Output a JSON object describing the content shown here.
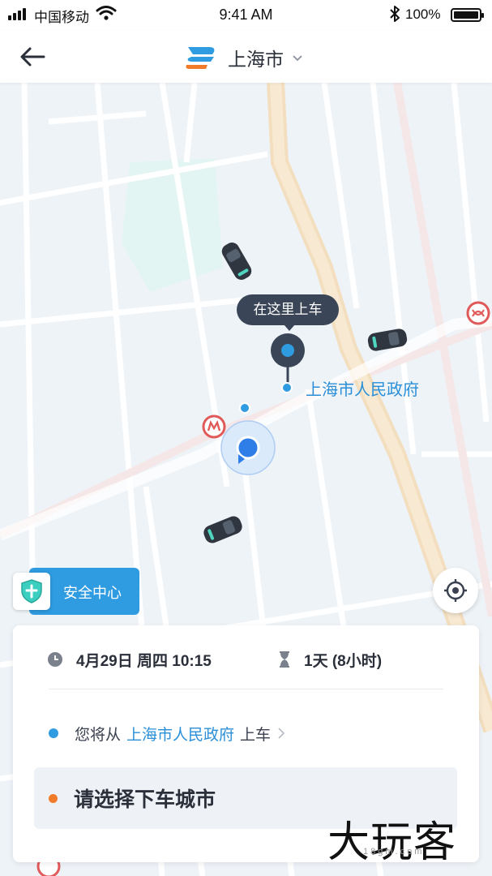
{
  "status_bar": {
    "carrier": "中国移动",
    "time": "9:41 AM",
    "battery_text": "100%",
    "battery_level": 1.0
  },
  "nav": {
    "back_icon": "back-arrow-icon",
    "logo_icon": "brand-logo-icon",
    "city": "上海市",
    "city_caret_icon": "chevron-down-icon"
  },
  "map": {
    "pickup_bubble": "在这里上车",
    "poi_label": "上海市人民政府",
    "metro_icon": "metro-icon",
    "car_icon": "car-icon",
    "safety_center_label": "安全中心",
    "safety_icon": "shield-cross-icon",
    "locate_icon": "locate-icon"
  },
  "card": {
    "datetime": "4月29日 周四 10:15",
    "duration": "1天 (8小时)",
    "pickup_prefix": "您将从",
    "pickup_location": "上海市人民政府",
    "pickup_suffix": "上车",
    "destination_prompt": "请选择下车城市",
    "colors": {
      "pickup_dot": "#2f9be0",
      "dest_dot": "#f27b2a",
      "accent": "#2a8fd8"
    }
  },
  "watermark": {
    "text": "大玩客",
    "subtext": "18gm.com"
  }
}
